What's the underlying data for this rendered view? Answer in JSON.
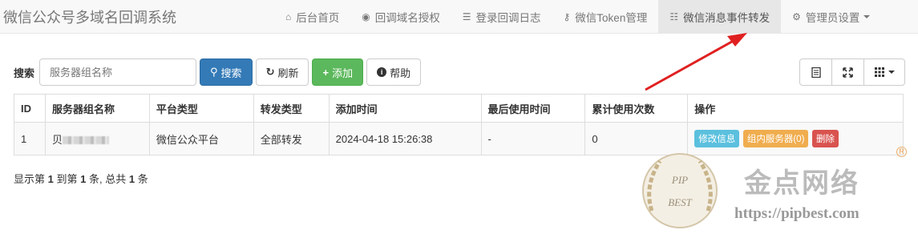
{
  "navbar": {
    "brand": "微信公众号多域名回调系统",
    "items": [
      {
        "label": "后台首页",
        "icon": "home-icon",
        "glyph": "⌂",
        "active": false
      },
      {
        "label": "回调域名授权",
        "icon": "globe-icon",
        "glyph": "◉",
        "active": false
      },
      {
        "label": "登录回调日志",
        "icon": "list-icon",
        "glyph": "☰",
        "active": false
      },
      {
        "label": "微信Token管理",
        "icon": "key-icon",
        "glyph": "⚷",
        "active": false
      },
      {
        "label": "微信消息事件转发",
        "icon": "tasks-icon",
        "glyph": "☷",
        "active": true
      },
      {
        "label": "管理员设置",
        "icon": "gear-icon",
        "glyph": "⚙",
        "active": false
      }
    ]
  },
  "toolbar": {
    "search_label": "搜索",
    "search_placeholder": "服务器组名称",
    "search_button": "搜索",
    "refresh_button": "刷新",
    "add_button": "添加",
    "help_button": "帮助"
  },
  "table": {
    "headers": [
      "ID",
      "服务器组名称",
      "平台类型",
      "转发类型",
      "添加时间",
      "最后使用时间",
      "累计使用次数",
      "操作"
    ],
    "rows": [
      {
        "id": "1",
        "name": "贝",
        "platform": "微信公众平台",
        "forward_type": "全部转发",
        "added": "2024-04-18 15:26:38",
        "last_used": "-",
        "count": "0",
        "actions": {
          "edit": "修改信息",
          "servers": "组内服务器(0)",
          "delete": "删除"
        }
      }
    ]
  },
  "pager": {
    "prefix": "显示第",
    "from": "1",
    "mid": "到第",
    "to": "1",
    "mid2": "条, 总共",
    "total": "1",
    "suffix": "条"
  },
  "watermark": {
    "brand": "金点网络",
    "url": "https://pipbest.com",
    "seal_top": "PIP",
    "seal_bottom": "BEST",
    "reg": "R"
  },
  "colors": {
    "primary": "#337ab7",
    "success": "#5cb85c",
    "info": "#5bc0de",
    "warning": "#f0ad4e",
    "danger": "#d9534f",
    "arrow": "#e02020"
  }
}
